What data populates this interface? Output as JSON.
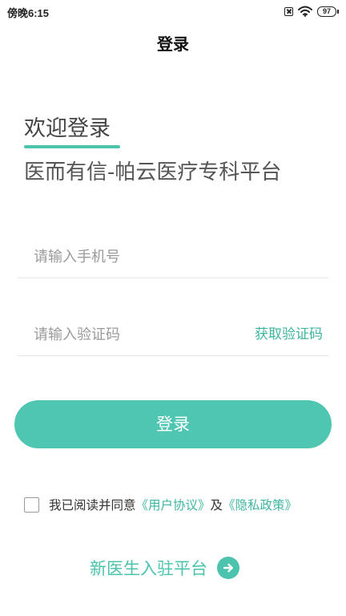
{
  "status_bar": {
    "time": "傍晚6:15",
    "battery": "97",
    "icons": [
      "sim-icon",
      "wifi-icon",
      "battery-icon"
    ]
  },
  "header": {
    "title": "登录"
  },
  "welcome": {
    "title": "欢迎登录",
    "subtitle": "医而有信-帕云医疗专科平台"
  },
  "form": {
    "phone_placeholder": "请输入手机号",
    "code_placeholder": "请输入验证码",
    "get_code_label": "获取验证码",
    "login_label": "登录"
  },
  "agreement": {
    "prefix": "我已阅读并同意",
    "user_agreement": "《用户协议》",
    "conjunction": "及",
    "privacy_policy": "《隐私政策》",
    "checked": false
  },
  "footer": {
    "new_doctor_label": "新医生入驻平台",
    "icon": "arrow-right-circle-icon"
  },
  "colors": {
    "accent": "#4fc6b1",
    "link": "#3fb5a0"
  }
}
